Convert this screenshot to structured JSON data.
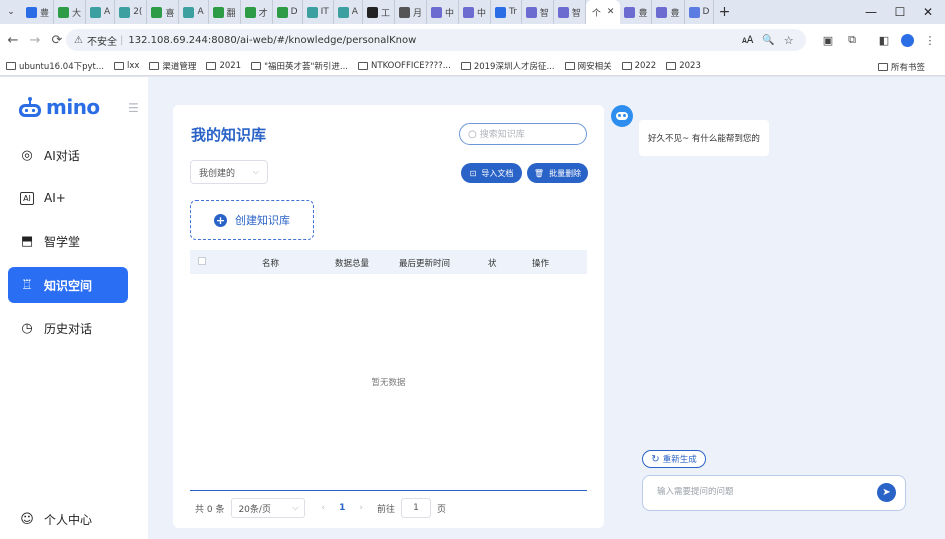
{
  "browser": {
    "tabs": [
      {
        "label": "豊",
        "color": "#2b6de5"
      },
      {
        "label": "大",
        "color": "#2e9b47"
      },
      {
        "label": "A",
        "color": "#3ca0a0"
      },
      {
        "label": "2(",
        "color": "#3ca0a0"
      },
      {
        "label": "喜",
        "color": "#2e9b47"
      },
      {
        "label": "A",
        "color": "#3ca0a0"
      },
      {
        "label": "翻",
        "color": "#2e9b47"
      },
      {
        "label": "才",
        "color": "#2e9b47"
      },
      {
        "label": "D",
        "color": "#2e9b47"
      },
      {
        "label": "IT",
        "color": "#3ca0a0"
      },
      {
        "label": "A",
        "color": "#3ca0a0"
      },
      {
        "label": "工",
        "color": "#222222"
      },
      {
        "label": "月",
        "color": "#555555"
      },
      {
        "label": "中",
        "color": "#6b6bd0"
      },
      {
        "label": "中",
        "color": "#6b6bd0"
      },
      {
        "label": "Tr",
        "color": "#2b6de5"
      },
      {
        "label": "智",
        "color": "#6b6bd0"
      },
      {
        "label": "智",
        "color": "#6b6bd0"
      }
    ],
    "active_tab": {
      "label": "个"
    },
    "tabs_after": [
      {
        "label": "豊",
        "color": "#6b6bd0"
      },
      {
        "label": "豊",
        "color": "#6b6bd0"
      },
      {
        "label": "D",
        "color": "#5b7ce0"
      }
    ],
    "new_tab": "+",
    "window": {
      "minimize": "—",
      "maximize": "☐",
      "close": "✕"
    },
    "security_label": "不安全",
    "url": "132.108.69.244:8080/ai-web/#/knowledge/personalKnow",
    "bookmarks": [
      "ubuntu16.04下pyt...",
      "lxx",
      "渠道管理",
      "2021",
      "\"福田英才荟\"新引进...",
      "NTKOOFFICE????...",
      "2019深圳人才房征...",
      "网安相关",
      "2022",
      "2023"
    ],
    "bookmarks_all": "所有书签"
  },
  "sidebar": {
    "logo_text": "mino",
    "items": [
      {
        "label": "AI对话"
      },
      {
        "label": "AI+"
      },
      {
        "label": "智学堂"
      },
      {
        "label": "知识空间"
      },
      {
        "label": "历史对话"
      }
    ],
    "user_label": "个人中心"
  },
  "knowledge": {
    "title": "我的知识库",
    "search_placeholder": "搜索知识库",
    "filter_value": "我创建的",
    "import_label": "导入文档",
    "batch_delete_label": "批量删除",
    "create_label": "创建知识库",
    "columns": [
      "名称",
      "数据总量",
      "最后更新时间",
      "状",
      "操作"
    ],
    "empty_text": "暂无数据",
    "pager": {
      "total": "共 0 条",
      "page_size": "20条/页",
      "current": "1",
      "goto": "前往",
      "goto_value": "1",
      "page_unit": "页"
    }
  },
  "chat": {
    "greeting": "好久不见~ 有什么能帮到您的",
    "regenerate_label": "重新生成",
    "input_placeholder": "输入需要提问的问题"
  },
  "colors": {
    "primary": "#2a63c7",
    "nav_active": "#2a6ef4"
  }
}
